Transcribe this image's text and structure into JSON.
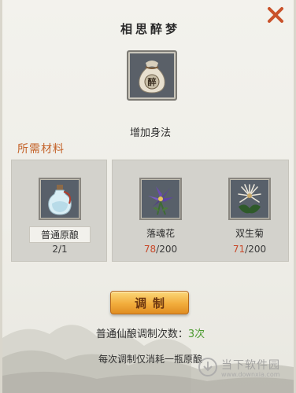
{
  "dialog": {
    "title": "相思醉梦",
    "item_glyph": "醉",
    "effect": "增加身法",
    "section_label": "所需材料"
  },
  "materials": [
    {
      "name": "普通原酿",
      "have": "2",
      "need": "/1",
      "icon": "spirit-flask-icon"
    },
    {
      "name": "落魂花",
      "have": "78",
      "need": "/200",
      "icon": "purple-flower-icon"
    },
    {
      "name": "双生菊",
      "have": "71",
      "need": "/200",
      "icon": "white-chrysanthemum-icon"
    }
  ],
  "craft": {
    "button_label": "调制",
    "count_label": "普通仙酿调制次数：",
    "count_value": "3次",
    "note": "每次调制仅消耗一瓶原酿"
  },
  "watermark": {
    "text": "当下软件园",
    "url": "www.downxia.com"
  },
  "colors": {
    "accent_orange": "#c4632a",
    "count_red": "#c8492a",
    "count_green": "#4a9a2e",
    "button_gold": "#f2ad3c"
  }
}
